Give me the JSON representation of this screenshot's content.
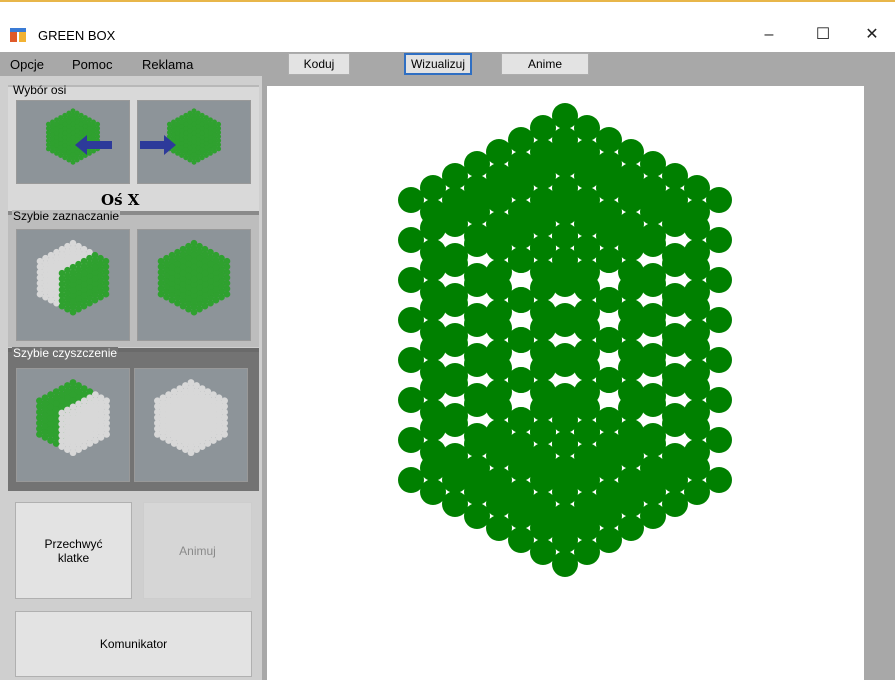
{
  "window": {
    "title": "GREEN BOX",
    "minimize": "–",
    "maximize": "☐",
    "close": "✕"
  },
  "menu": {
    "items": [
      "Opcje",
      "Pomoc",
      "Reklama"
    ]
  },
  "toolbar": {
    "koduj": "Koduj",
    "wizualizuj": "Wizualizuj",
    "anime": "Anime",
    "active": "Wizualizuj"
  },
  "panel": {
    "axis_group_title": "Wybór osi",
    "axis_label": "Oś X",
    "quick_select_title": "Szybie zaznaczanie",
    "quick_clear_title": "Szybie czyszczenie",
    "capture_button": "Przechwyć klatke",
    "animate_button": "Animuj",
    "communicator_button": "Komunikator"
  },
  "colors": {
    "sphere": "#008000",
    "sphere_light": "#2fa12f",
    "sphere_white": "#d8d8d8",
    "accent": "#2f6fc3",
    "arrow": "#2d3a9a"
  },
  "icons": {
    "app": "green-box-app-icon"
  }
}
